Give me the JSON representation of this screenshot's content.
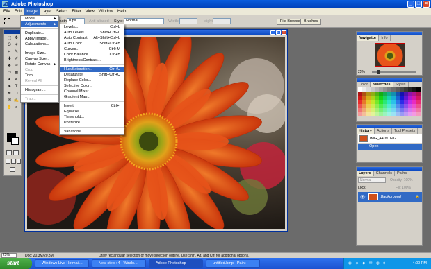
{
  "window": {
    "title": "Adobe Photoshop",
    "min": "_",
    "max": "□",
    "close": "×"
  },
  "menubar": [
    "File",
    "Edit",
    "Image",
    "Layer",
    "Select",
    "Filter",
    "View",
    "Window",
    "Help"
  ],
  "options": {
    "feather_label": "Feather:",
    "feather_value": "0 px",
    "anti_alias": "Anti-aliased",
    "style_label": "Style:",
    "style_value": "Normal",
    "width_label": "Width:",
    "height_label": "Height:",
    "file_browser": "File Browser",
    "brushes": "Brushes"
  },
  "image_menu": [
    {
      "label": "Mode",
      "sub": true
    },
    {
      "label": "Adjustments",
      "sub": true,
      "highlight": true
    },
    {
      "sep": true
    },
    {
      "label": "Duplicate..."
    },
    {
      "label": "Apply Image..."
    },
    {
      "label": "Calculations..."
    },
    {
      "sep": true
    },
    {
      "label": "Image Size..."
    },
    {
      "label": "Canvas Size..."
    },
    {
      "label": "Rotate Canvas",
      "sub": true
    },
    {
      "label": "Crop",
      "disabled": true
    },
    {
      "label": "Trim..."
    },
    {
      "label": "Reveal All",
      "disabled": true
    },
    {
      "sep": true
    },
    {
      "label": "Histogram..."
    },
    {
      "sep": true
    },
    {
      "label": "Trap...",
      "disabled": true
    }
  ],
  "adjust_menu": [
    {
      "label": "Levels...",
      "shortcut": "Ctrl+L"
    },
    {
      "label": "Auto Levels",
      "shortcut": "Shift+Ctrl+L"
    },
    {
      "label": "Auto Contrast",
      "shortcut": "Alt+Shift+Ctrl+L"
    },
    {
      "label": "Auto Color",
      "shortcut": "Shift+Ctrl+B"
    },
    {
      "label": "Curves...",
      "shortcut": "Ctrl+M"
    },
    {
      "label": "Color Balance...",
      "shortcut": "Ctrl+B"
    },
    {
      "label": "Brightness/Contrast..."
    },
    {
      "sep": true
    },
    {
      "label": "Hue/Saturation...",
      "shortcut": "Ctrl+U",
      "highlight": true
    },
    {
      "label": "Desaturate",
      "shortcut": "Shift+Ctrl+U"
    },
    {
      "label": "Replace Color..."
    },
    {
      "label": "Selective Color..."
    },
    {
      "label": "Channel Mixer..."
    },
    {
      "label": "Gradient Map..."
    },
    {
      "sep": true
    },
    {
      "label": "Invert",
      "shortcut": "Ctrl+I"
    },
    {
      "label": "Equalize"
    },
    {
      "label": "Threshold..."
    },
    {
      "label": "Posterize..."
    },
    {
      "sep": true
    },
    {
      "label": "Variations..."
    }
  ],
  "navigator": {
    "tabs": [
      "Navigator",
      "Info"
    ],
    "zoom": "25%"
  },
  "swatches": {
    "tabs": [
      "Color",
      "Swatches",
      "Styles"
    ]
  },
  "history": {
    "tabs": [
      "History",
      "Actions",
      "Tool Presets"
    ],
    "file": "IMG_4409.JPG",
    "step": "Open"
  },
  "layers": {
    "tabs": [
      "Layers",
      "Channels",
      "Paths"
    ],
    "blend": "Normal",
    "opacity": "Opacity: 100%",
    "lock_label": "Lock:",
    "fill": "Fill: 100%",
    "layer_name": "Background"
  },
  "status": {
    "zoom": "25%",
    "doc": "Doc: 20.3M/20.3M",
    "hint": "Draw rectangular selection or move selection outline. Use Shift, Alt, and Ctrl for additional options."
  },
  "taskbar": {
    "start": "start",
    "items": [
      "Windows Live Hotmail...",
      "New step : 4 - Windo...",
      "Adobe Photoshop",
      "untitled.bmp - Paint"
    ],
    "clock": "4:00 PM"
  },
  "colors": {
    "accent": "#316ac5",
    "xp_blue": "#0a5ddd",
    "flower": "#e8541a"
  }
}
